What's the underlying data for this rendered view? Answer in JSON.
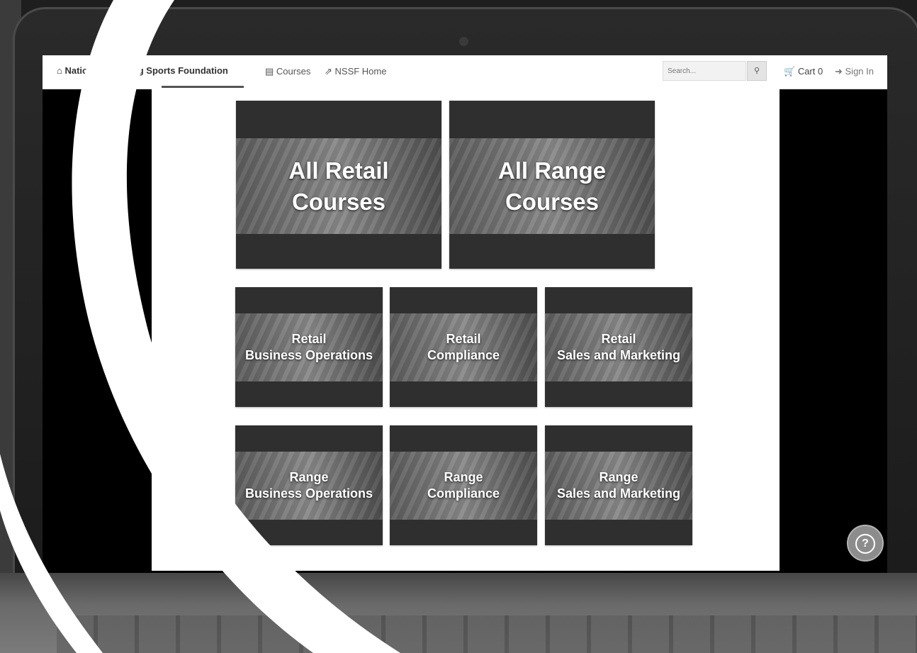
{
  "navbar": {
    "brand": "National Shooting Sports Foundation",
    "courses_label": "Courses",
    "home_label": "NSSF Home",
    "search_placeholder": "Search...",
    "cart_label": "Cart 0",
    "signin_label": "Sign In"
  },
  "tiles_top": [
    {
      "line1": "All Retail",
      "line2": "Courses"
    },
    {
      "line1": "All Range",
      "line2": "Courses"
    }
  ],
  "tiles_retail": [
    {
      "line1": "Retail",
      "line2": "Business Operations"
    },
    {
      "line1": "Retail",
      "line2": "Compliance"
    },
    {
      "line1": "Retail",
      "line2": "Sales and Marketing"
    }
  ],
  "tiles_range": [
    {
      "line1": "Range",
      "line2": "Business Operations"
    },
    {
      "line1": "Range",
      "line2": "Compliance"
    },
    {
      "line1": "Range",
      "line2": "Sales and Marketing"
    }
  ],
  "help": {
    "icon": "question-circle-icon"
  }
}
